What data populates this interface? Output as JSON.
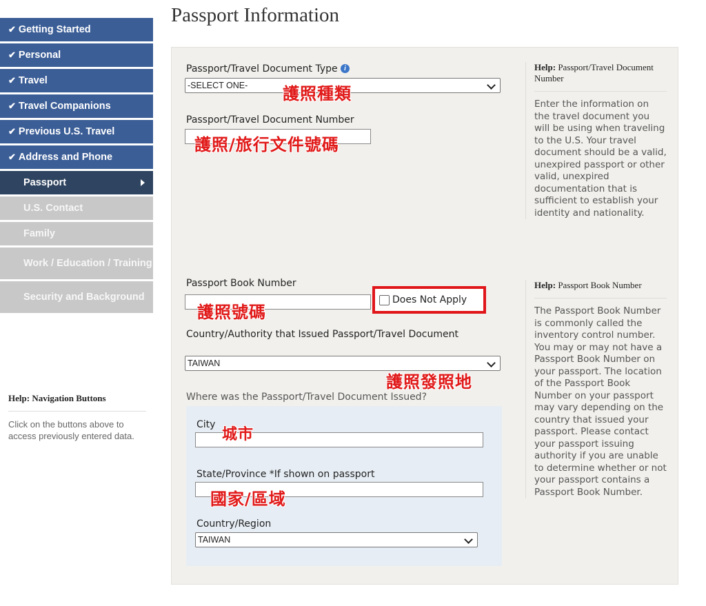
{
  "sidebar": {
    "items": [
      {
        "label": "Getting Started",
        "check": "✔"
      },
      {
        "label": "Personal",
        "check": "✔"
      },
      {
        "label": "Travel",
        "check": "✔"
      },
      {
        "label": "Travel Companions",
        "check": "✔"
      },
      {
        "label": "Previous U.S. Travel",
        "check": "✔"
      },
      {
        "label": "Address and Phone",
        "check": "✔"
      },
      {
        "label": "Passport"
      },
      {
        "label": "U.S. Contact"
      },
      {
        "label": "Family"
      },
      {
        "label": "Work / Education / Training"
      },
      {
        "label": "Security and Background"
      }
    ],
    "help": {
      "prefix": "Help:",
      "title": "Navigation Buttons",
      "body": "Click on the buttons above to access previously entered data."
    }
  },
  "page": {
    "title": "Passport Information"
  },
  "form": {
    "doc_type_label": "Passport/Travel Document Type",
    "doc_type_value": "-SELECT ONE-",
    "doc_number_label": "Passport/Travel Document Number",
    "book_number_label": "Passport Book Number",
    "does_not_apply": "Does Not Apply",
    "issuing_country_label": "Country/Authority that Issued Passport/Travel Document",
    "issuing_country_value": "TAIWAN",
    "where_issued_label": "Where was the Passport/Travel Document Issued?",
    "city_label": "City",
    "state_label": "State/Province *If shown on passport",
    "country_label": "Country/Region",
    "country_value": "TAIWAN"
  },
  "annotations": {
    "doc_type": "護照種類",
    "doc_number": "護照/旅行文件號碼",
    "book_number": "護照號碼",
    "issuing_place": "護照發照地",
    "city": "城市",
    "state": "國家/區域"
  },
  "help_panels": {
    "doc_number": {
      "prefix": "Help:",
      "title": "Passport/Travel Document Number",
      "body": "Enter the information on the travel document you will be using when traveling to the U.S. Your travel document should be a valid, unexpired passport or other valid, unexpired documentation that is sufficient to establish your identity and nationality."
    },
    "book_number": {
      "prefix": "Help:",
      "title": "Passport Book Number",
      "body": "The Passport Book Number is commonly called the inventory control number. You may or may not have a Passport Book Number on your passport. The location of the Passport Book Number on your passport may vary depending on the country that issued your passport. Please contact your passport issuing authority if you are unable to determine whether or not your passport contains a Passport Book Number."
    }
  },
  "colors": {
    "nav_done": "#3b5e97",
    "nav_current": "#2f4460",
    "nav_todo": "#c8c8c8",
    "annotation_red": "#e11919"
  }
}
